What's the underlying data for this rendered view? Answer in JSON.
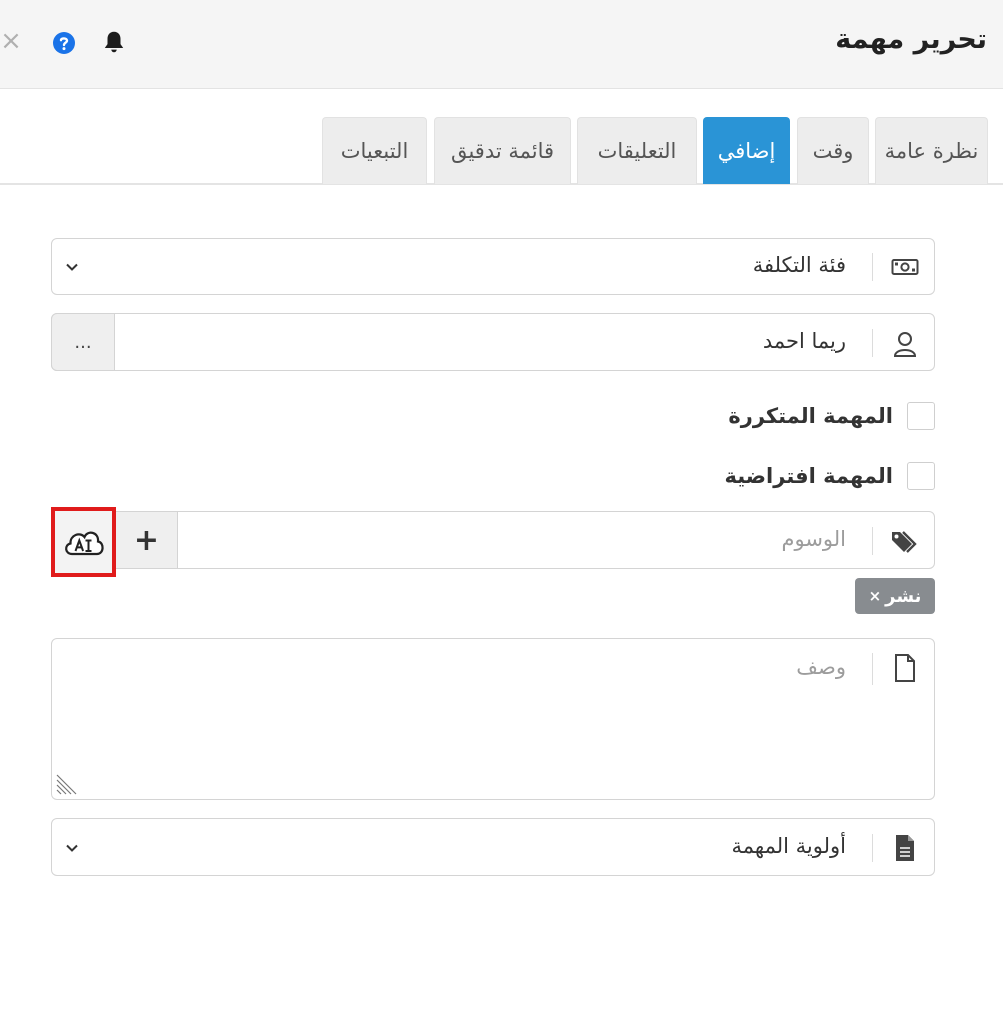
{
  "header": {
    "title": "تحرير مهمة",
    "close_label": "×",
    "icons": {
      "help": "help-circle-icon",
      "notifications": "bell-icon",
      "close": "close-icon"
    },
    "help_color": "#1a73e8"
  },
  "tabs": [
    {
      "label": "نظرة عامة",
      "active": false
    },
    {
      "label": "وقت",
      "active": false
    },
    {
      "label": "إضافي",
      "active": true
    },
    {
      "label": "التعليقات",
      "active": false
    },
    {
      "label": "قائمة تدقيق",
      "active": false
    },
    {
      "label": "التبعيات",
      "active": false
    }
  ],
  "accent_color": "#2a94d6",
  "form": {
    "cost_category": {
      "value": "فئة التكلفة",
      "icon": "money-bill-icon"
    },
    "assignee": {
      "value": "ريما احمد",
      "icon": "user-icon",
      "more_label": "..."
    },
    "recurring_task": {
      "label": "المهمة المتكررة",
      "checked": false
    },
    "virtual_task": {
      "label": "المهمة افتراضية",
      "checked": false
    },
    "tags": {
      "placeholder": "الوسوم",
      "icon": "tags-icon",
      "add_label": "+",
      "ai_icon": "ai-cloud-icon",
      "chips": [
        {
          "label": "نشر",
          "remove": "×"
        }
      ]
    },
    "description": {
      "placeholder": "وصف",
      "icon": "file-icon"
    },
    "priority": {
      "value": "أولوية المهمة",
      "icon": "file-text-icon"
    }
  },
  "highlight_color": "#e01b1b"
}
